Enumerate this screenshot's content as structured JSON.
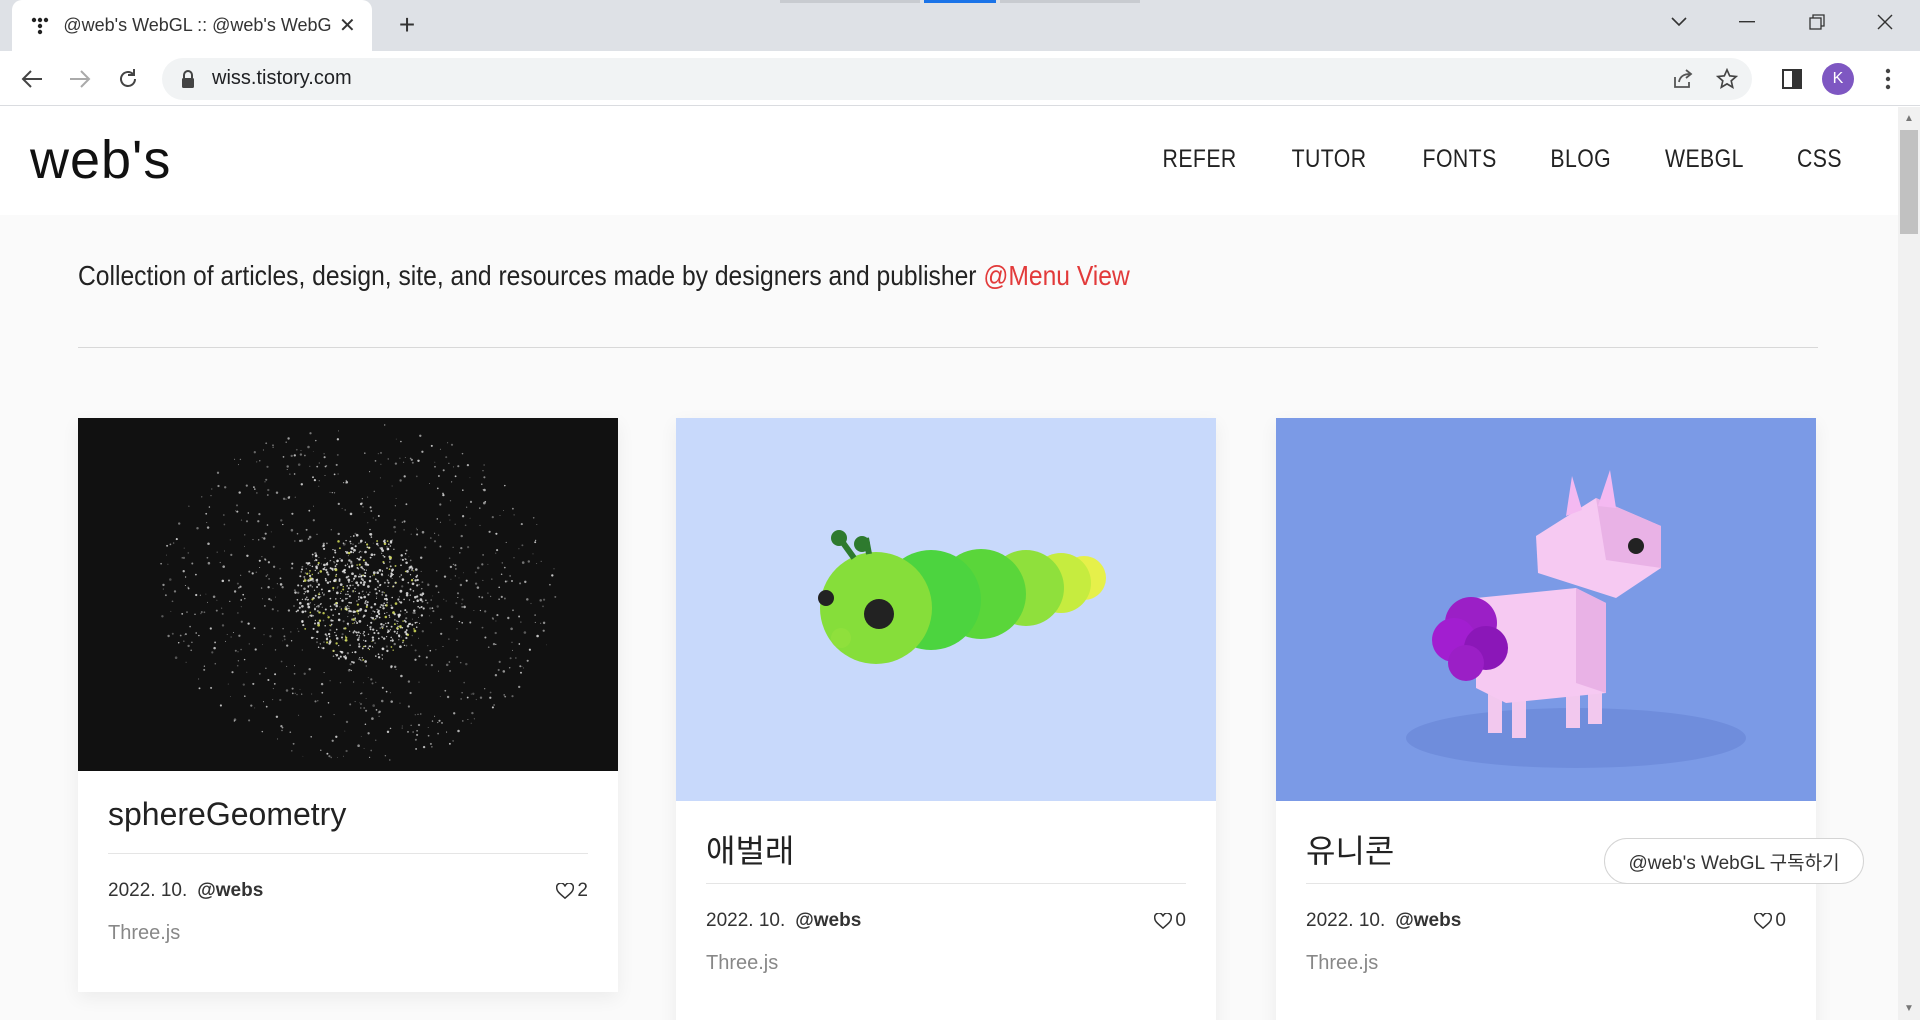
{
  "browser": {
    "tab_title": "@web's WebGL :: @web's WebGL",
    "new_tab_icon": "plus-icon",
    "url": "wiss.tistory.com",
    "profile_initial": "K"
  },
  "site": {
    "logo": "web's",
    "menu": [
      "REFER",
      "TUTOR",
      "FONTS",
      "BLOG",
      "WEBGL",
      "CSS"
    ],
    "tagline": "Collection of articles, design, site, and resources made by designers and publisher ",
    "tagline_link": "@Menu View",
    "accent_color": "#e23a3a"
  },
  "cards": [
    {
      "title": "sphereGeometry",
      "date": "2022. 10.",
      "author": "@webs",
      "likes": "2",
      "category": "Three.js",
      "thumb_bg": "#111111"
    },
    {
      "title": "애벌래",
      "date": "2022. 10.",
      "author": "@webs",
      "likes": "0",
      "category": "Three.js",
      "thumb_bg": "#c8d9fb"
    },
    {
      "title": "유니콘",
      "date": "2022. 10.",
      "author": "@webs",
      "likes": "0",
      "category": "Three.js",
      "thumb_bg": "#7b9ae6"
    }
  ],
  "subscribe_label": "@web's WebGL 구독하기"
}
